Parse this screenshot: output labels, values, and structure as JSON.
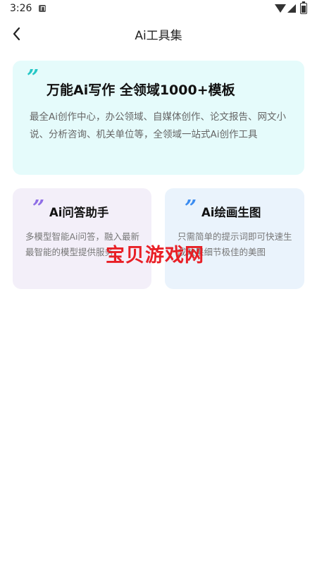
{
  "status_bar": {
    "time": "3:26"
  },
  "header": {
    "title": "Ai工具集"
  },
  "cards": {
    "main": {
      "quote": "”",
      "title": "万能Ai写作 全领域1000+模板",
      "description": "最全Ai创作中心，办公领域、自媒体创作、论文报告、网文小说、分析咨询、机关单位等，全领域一站式Ai创作工具"
    },
    "qa": {
      "quote": "”",
      "title": "Ai问答助手",
      "description": "多模型智能Ai问答，融入最新最智能的模型提供服务"
    },
    "draw": {
      "quote": "”",
      "title": "Ai绘画生图",
      "description": "只需简单的提示词即可快速生成效果细节极佳的美图"
    }
  },
  "watermark": "宝贝游戏网",
  "colors": {
    "main_card_bg": "#e5fbfb",
    "qa_card_bg": "#f3eff9",
    "draw_card_bg": "#eaf3fc",
    "main_quote": "#25c7c6",
    "qa_quote": "#8f6ee6",
    "draw_quote": "#3b8cf0",
    "watermark": "#e8141b"
  }
}
